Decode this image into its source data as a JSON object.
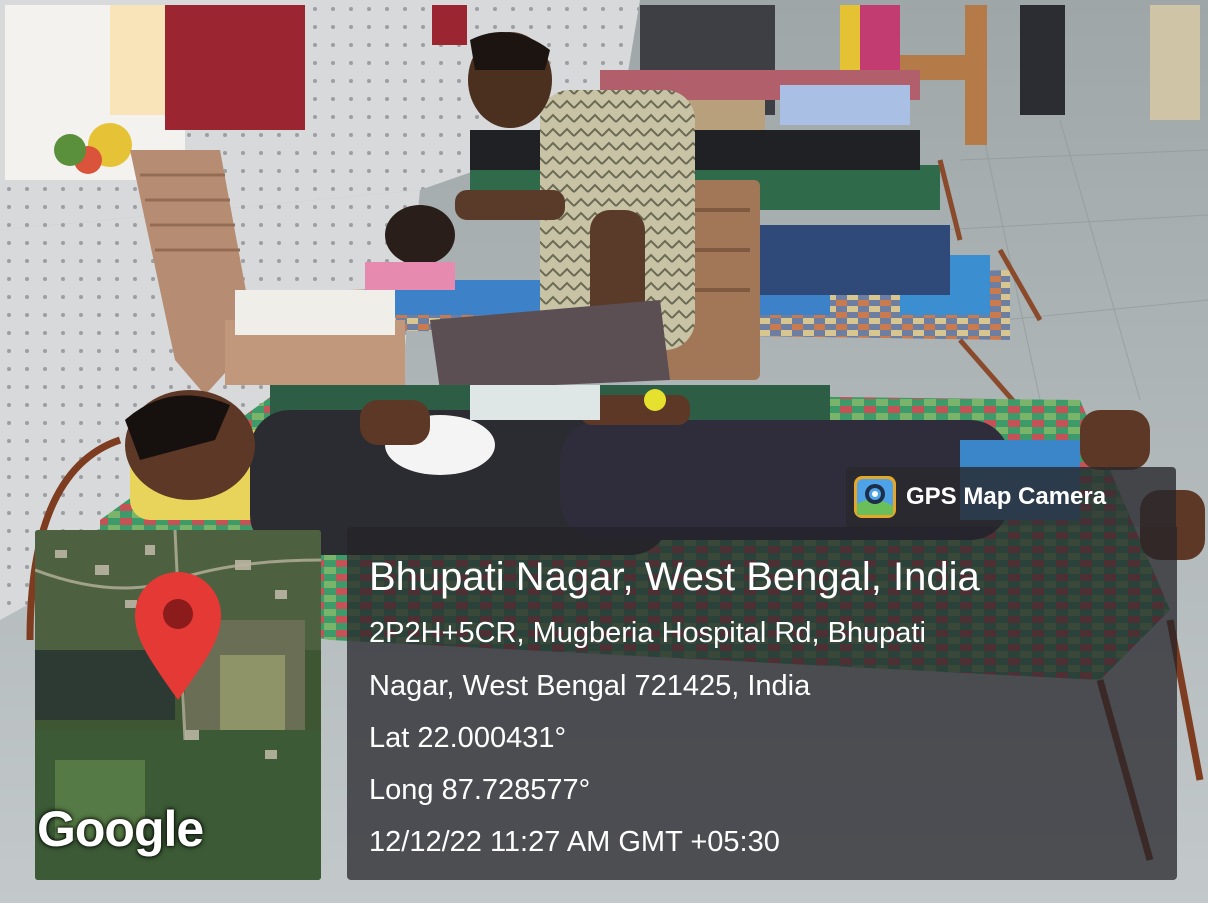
{
  "overlay": {
    "app_name": "GPS Map Camera",
    "place": "Bhupati Nagar, West Bengal, India",
    "address_line1": "2P2H+5CR, Mugberia Hospital Rd, Bhupati",
    "address_line2": "Nagar, West Bengal 721425, India",
    "latitude": "Lat 22.000431°",
    "longitude": "Long 87.728577°",
    "datetime": "12/12/22 11:27 AM GMT +05:30"
  },
  "map": {
    "logo_text": "Google",
    "pin_color": "#e53935"
  }
}
